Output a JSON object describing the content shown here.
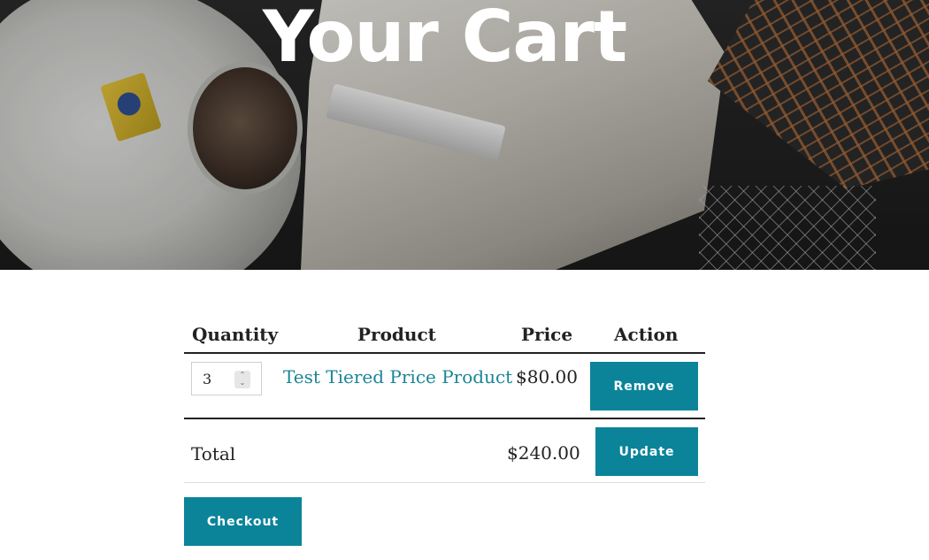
{
  "hero": {
    "title": "Your Cart"
  },
  "cart": {
    "headers": {
      "quantity": "Quantity",
      "product": "Product",
      "price": "Price",
      "action": "Action"
    },
    "items": [
      {
        "quantity": "3",
        "product": "Test Tiered Price Product",
        "price": "$80.00",
        "action": "Remove"
      }
    ],
    "total_label": "Total",
    "total_value": "$240.00",
    "update_label": "Update",
    "checkout_label": "Checkout"
  },
  "colors": {
    "accent": "#0b849a",
    "link": "#1a8597",
    "text": "#222222"
  }
}
